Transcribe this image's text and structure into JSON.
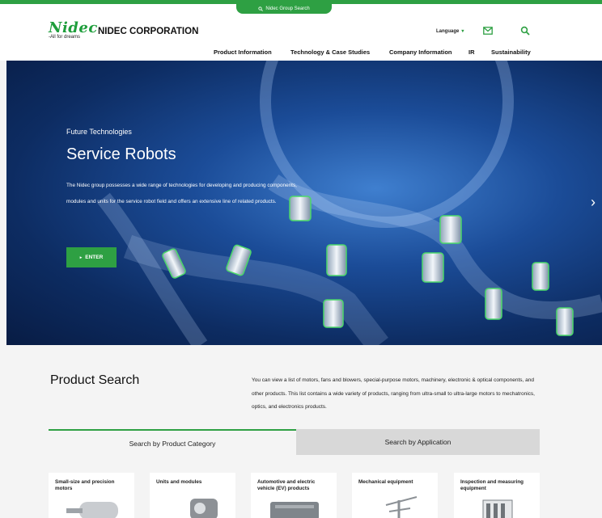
{
  "topbar": {
    "group_search_label": "Nidec Group Search"
  },
  "header": {
    "logo_mark": "Nidec",
    "logo_tagline": "-All for dreams",
    "company_name": "NIDEC CORPORATION",
    "language_label": "Language"
  },
  "nav": {
    "items": [
      {
        "label": "Product Information"
      },
      {
        "label": "Technology & Case Studies"
      },
      {
        "label": "Company Information"
      },
      {
        "label": "IR"
      },
      {
        "label": "Sustainability"
      }
    ]
  },
  "hero": {
    "eyebrow": "Future Technologies",
    "title": "Service Robots",
    "description": "The Nidec group possesses a wide range of technologies for developing and producing components, modules and units for the service robot field and offers an extensive line of related products.",
    "enter_label": "ENTER"
  },
  "product_search": {
    "title": "Product Search",
    "description": "You can view a list of motors, fans and blowers, special-purpose motors, machinery, electronic & optical components, and other products. This list contains a wide variety of products, ranging from ultra-small to ultra-large motors to mechatronics, optics, and electronics products.",
    "tabs": [
      {
        "label": "Search by Product Category",
        "active": true
      },
      {
        "label": "Search by Application",
        "active": false
      }
    ],
    "categories": [
      {
        "label": "Small-size and precision motors"
      },
      {
        "label": "Units and modules"
      },
      {
        "label": "Automotive and electric vehicle (EV) products"
      },
      {
        "label": "Mechanical equipment"
      },
      {
        "label": "Inspection and measuring equipment"
      }
    ]
  },
  "colors": {
    "brand_green": "#2ea043",
    "hero_blue": "#1b4c98"
  }
}
